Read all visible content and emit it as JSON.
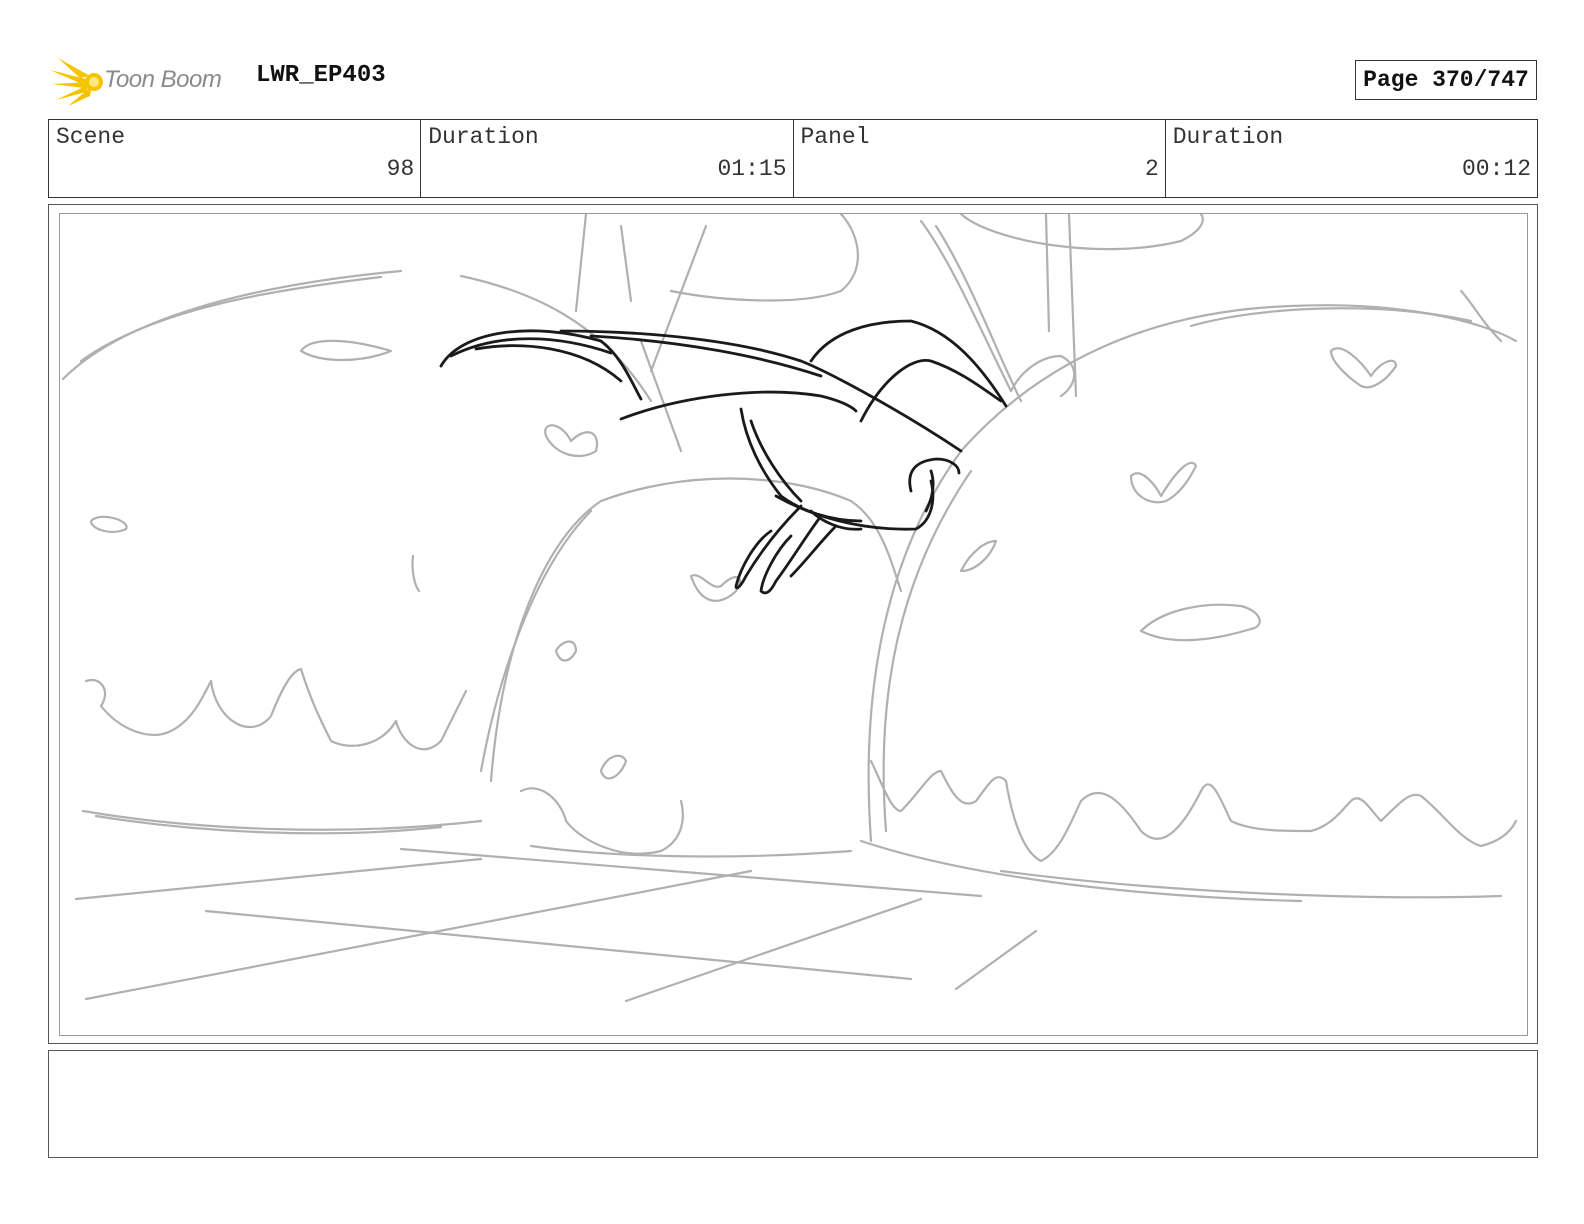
{
  "header": {
    "logo_text": "Toon Boom",
    "project": "LWR_EP403",
    "page": "Page 370/747"
  },
  "info": {
    "scene_label": "Scene",
    "scene_value": "98",
    "scene_duration_label": "Duration",
    "scene_duration_value": "01:15",
    "panel_label": "Panel",
    "panel_value": "2",
    "panel_duration_label": "Duration",
    "panel_duration_value": "00:12"
  },
  "colors": {
    "logo_yellow": "#f5c400",
    "sketch_grey": "#b0b0b0",
    "sketch_dark": "#1a1a1a"
  }
}
